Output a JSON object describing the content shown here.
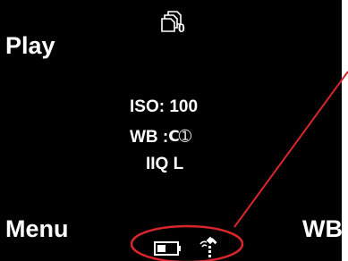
{
  "softkeys": {
    "top_left": "Play",
    "bottom_left": "Menu",
    "bottom_right": "WB"
  },
  "card": {
    "count": "0",
    "icon": "memory-card-icon"
  },
  "settings": {
    "iso_label": "ISO:",
    "iso_value": "100",
    "wb_label": "WB :",
    "wb_mode": "C➀",
    "format": "IIQ L"
  },
  "status": {
    "battery_icon": "battery-icon",
    "gps_icon": "gps-signal-icon"
  },
  "annotation": {
    "color": "#d8262c"
  },
  "colors": {
    "screen_background": "#000000",
    "text": "#ffffff",
    "annotation_red": "#d8262c"
  }
}
